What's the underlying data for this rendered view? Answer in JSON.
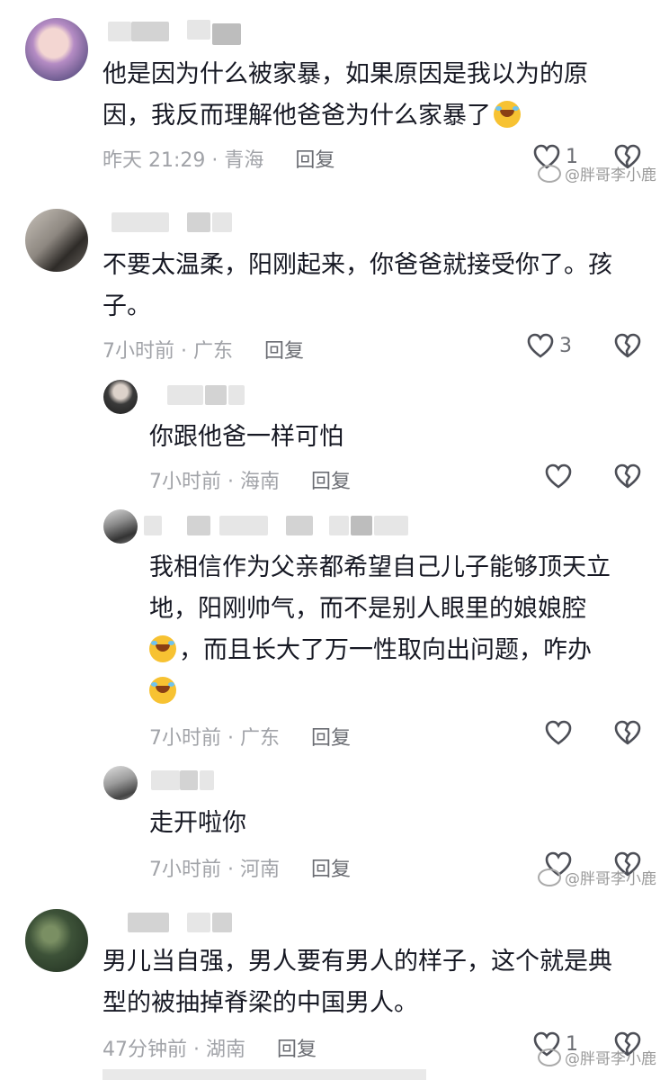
{
  "comments": [
    {
      "text_line1": "他是因为什么被家暴，如果原因是我以为的原",
      "text_line2": "因，我反而理解他爸爸为什么家暴了",
      "time_loc": "昨天 21:29 · 青海",
      "reply_label": "回复",
      "likes": "1"
    },
    {
      "text_line1": "不要太温柔，阳刚起来，你爸爸就接受你了。孩",
      "text_line2": "子。",
      "time_loc": "7小时前 · 广东",
      "reply_label": "回复",
      "likes": "3"
    },
    {
      "text_line1": "你跟他爸一样可怕",
      "time_loc": "7小时前 · 海南",
      "reply_label": "回复"
    },
    {
      "text_line1": "我相信作为父亲都希望自己儿子能够顶天立",
      "text_line2": "地，阳刚帅气，而不是别人眼里的娘娘腔",
      "text_line3": "，而且长大了万一性取向出问题，咋办",
      "time_loc": "7小时前 · 广东",
      "reply_label": "回复"
    },
    {
      "text_line1": "走开啦你",
      "time_loc": "7小时前 · 河南",
      "reply_label": "回复"
    },
    {
      "text_line1": "男儿当自强，男人要有男人的样子，这个就是典",
      "text_line2": "型的被抽掉脊梁的中国男人。",
      "time_loc": "47分钟前 · 湖南",
      "reply_label": "回复",
      "likes": "1"
    }
  ],
  "watermark": "@胖哥李小鹿",
  "icons": [
    "heart-icon",
    "broken-heart-icon",
    "laughing-crying-emoji"
  ]
}
